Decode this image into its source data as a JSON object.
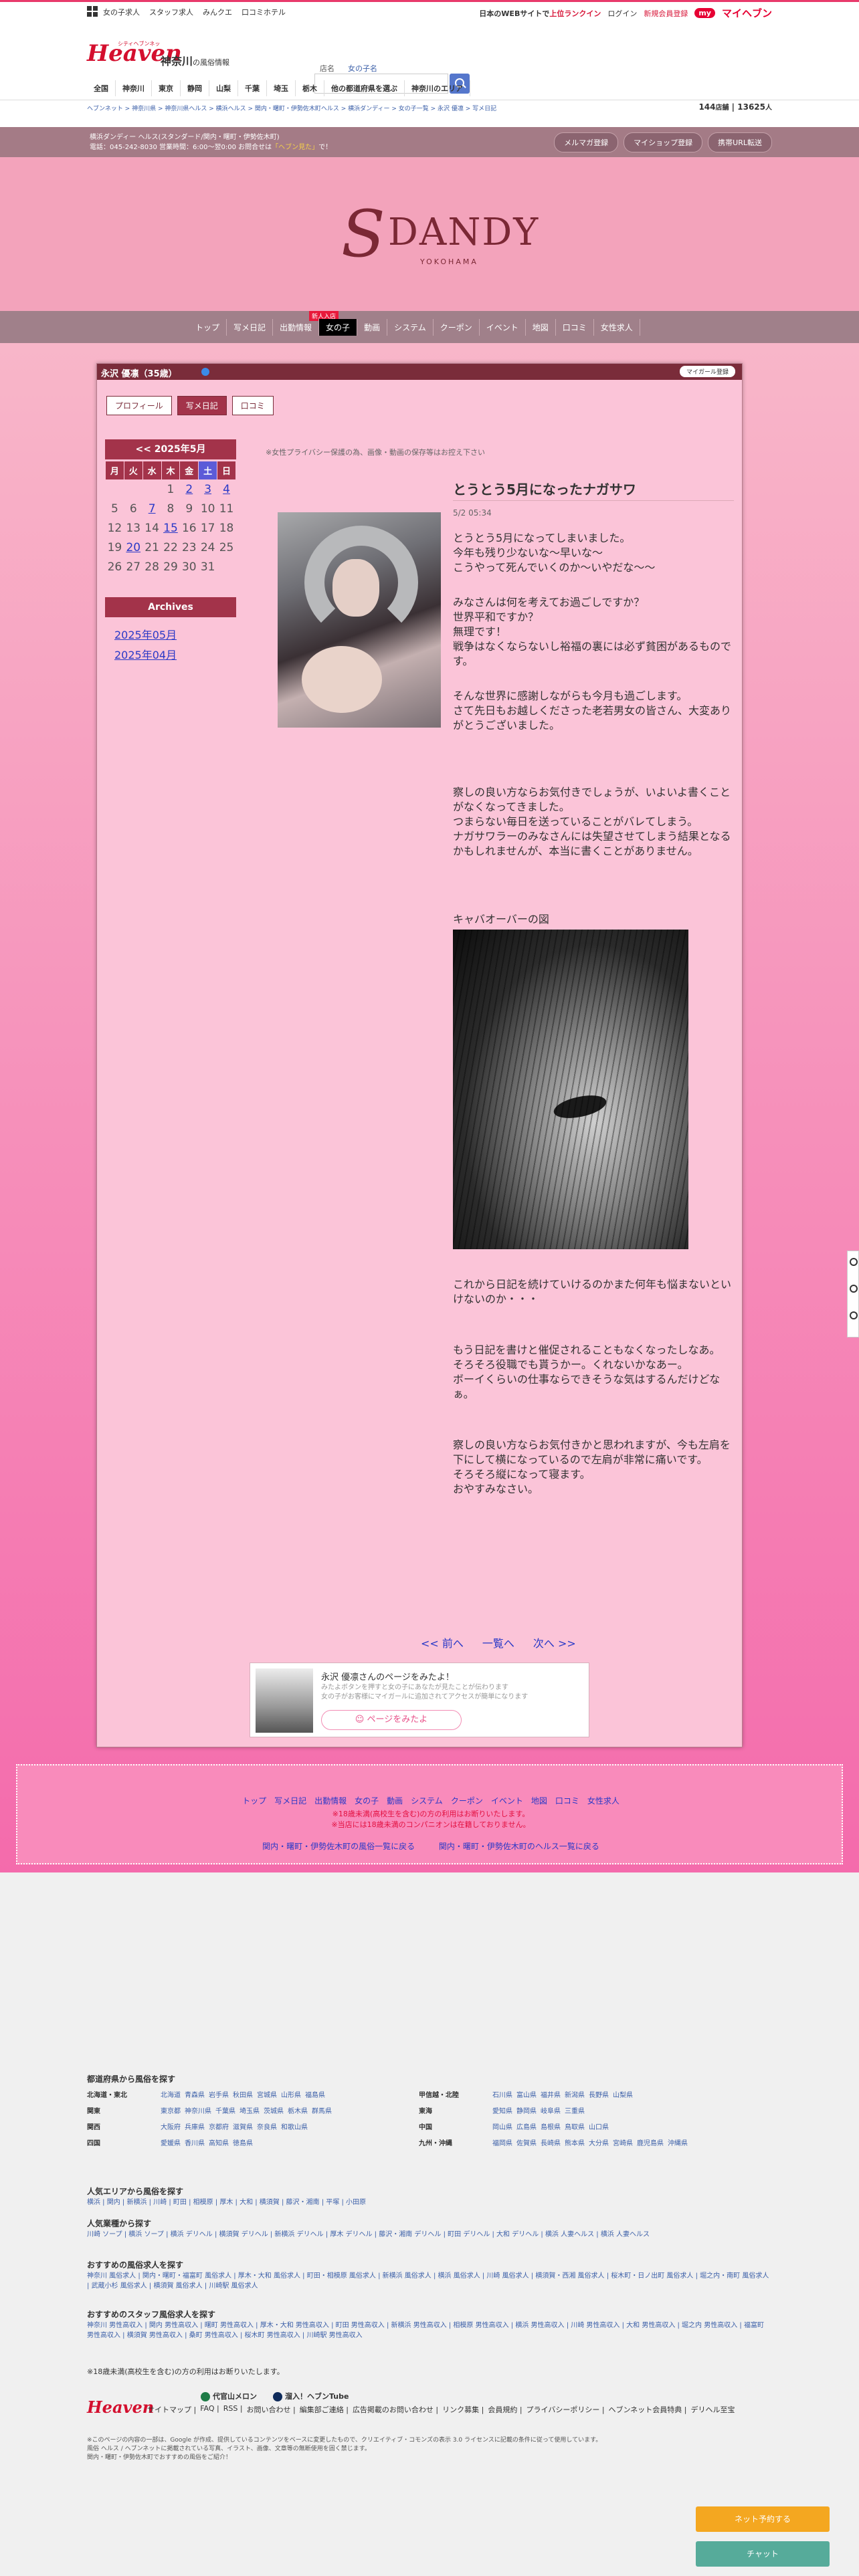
{
  "topbar": {
    "links": [
      "女の子求人",
      "スタッフ求人",
      "みんクエ",
      "口コミホテル"
    ],
    "right_text_a": "日本の",
    "right_text_b": "WEB",
    "right_text_c": "サイトで",
    "right_highlight": "上位ランクイン",
    "login": "ログイン",
    "register": "新規会員登録",
    "my_badge": "my",
    "myheaven": "マイヘブン"
  },
  "header": {
    "logo_text": "Heaven",
    "logo_sub": "シティヘブンネット",
    "region": "神奈川",
    "region_suffix": "の風俗情報",
    "search_label": "店名",
    "search_value": "女の子名",
    "area_nav": [
      "全国",
      "神奈川",
      "東京",
      "静岡",
      "山梨",
      "千葉",
      "埼玉",
      "栃木",
      "他の都道府県を選ぶ",
      "神奈川のエリア"
    ],
    "breadcrumb": "ヘブンネット > 神奈川県 > 神奈川県ヘルス > 横浜ヘルス > 関内・曙町・伊勢佐木町ヘルス > 横浜ダンディー > 女の子一覧 > 永沢 優凛 > 写メ日記",
    "shop_count": "144",
    "shop_unit": "店舗",
    "girl_count": "13625",
    "girl_unit": "人"
  },
  "shopbar": {
    "line1": "横浜ダンディー ヘルス(スタンダード/関内・曙町・伊勢佐木町)",
    "line2a": "電話：045-242-8030 営業時間：6:00〜翌0:00 お問合せは",
    "line2b": "「ヘブン見た」",
    "line2c": "で！",
    "buttons": [
      "メルマガ登録",
      "マイショップ登録",
      "携帯URL転送"
    ]
  },
  "hero": {
    "logo_s": "S",
    "logo_name": "DANDY",
    "logo_city": "YOKOHAMA"
  },
  "gnav": {
    "items": [
      "トップ",
      "写メ日記",
      "出勤情報",
      "女の子",
      "動画",
      "システム",
      "クーポン",
      "イベント",
      "地図",
      "口コミ",
      "女性求人"
    ],
    "new_badge": "新人入店"
  },
  "panel": {
    "girl_name": "永沢 優凛（35歳）",
    "mygirl_btn": "マイガール登録",
    "tabs": [
      "プロフィール",
      "写メ日記",
      "口コミ"
    ]
  },
  "calendar": {
    "title": "<< 2025年5月",
    "weekdays": [
      "月",
      "火",
      "水",
      "木",
      "金",
      "土",
      "日"
    ],
    "weeks": [
      [
        "",
        "",
        "",
        "1",
        "2",
        "3",
        "4"
      ],
      [
        "5",
        "6",
        "7",
        "8",
        "9",
        "10",
        "11"
      ],
      [
        "12",
        "13",
        "14",
        "15",
        "16",
        "17",
        "18"
      ],
      [
        "19",
        "20",
        "21",
        "22",
        "23",
        "24",
        "25"
      ],
      [
        "26",
        "27",
        "28",
        "29",
        "30",
        "31",
        ""
      ]
    ],
    "linked_days": [
      "2",
      "3",
      "4",
      "7",
      "15",
      "20"
    ],
    "archives_title": "Archives",
    "archives": [
      "2025年05月",
      "2025年04月"
    ]
  },
  "diary": {
    "privacy_note": "※女性プライバシー保護の為、画像・動画の保存等はお控え下さい",
    "title": "とうとう5月になったナガサワ",
    "date": "5/2 05:34",
    "para1": "とうとう5月になってしまいました。\n今年も残り少ないな〜早いな〜\nこうやって死んでいくのか〜いやだな〜〜",
    "para2": "みなさんは何を考えてお過ごしですか？\n世界平和ですか？\n無理です！\n戦争はなくならないし裕福の裏には必ず貧困があるものです。",
    "para3": "そんな世界に感謝しながらも今月も過ごします。\nさて先日もお越しくださった老若男女の皆さん、大変ありがとうございました。",
    "para4": "察しの良い方ならお気付きでしょうが、いよいよ書くことがなくなってきました。\nつまらない毎日を送っていることがバレてしまう。\nナガサワラーのみなさんには失望させてしまう結果となるかもしれませんが、本当に書くことがありません。",
    "caption": "キャバオーバーの図",
    "para5": "これから日記を続けていけるのかまた何年も悩まないといけないのか・・・",
    "para6": "もう日記を書けと催促されることもなくなったしなあ。\nそろそろ役職でも貰うかー。くれないかなあー。\nボーイくらいの仕事ならできそうな気はするんだけどなぁ。",
    "para7": "察しの良い方ならお気付きかと思われますが、今も左肩を下にして横になっているので左肩が非常に痛いです。\nそろそろ縦になって寝ます。\nおやすみなさい。"
  },
  "pager": [
    "<< 前へ",
    "一覧へ",
    "次へ >>"
  ],
  "profile_card": {
    "title": "永沢 優凛さんのページをみたよ！",
    "desc1": "みたよボタンを押すと女の子にあなたが見たことが伝わります",
    "desc2": "女の子がお客様にマイガールに追加されてアクセスが簡単になります",
    "button": "ページをみたよ"
  },
  "footer_box": {
    "links": [
      "トップ",
      "写メ日記",
      "出勤情報",
      "女の子",
      "動画",
      "システム",
      "クーポン",
      "イベント",
      "地図",
      "口コミ",
      "女性求人"
    ],
    "note1": "※18歳未満(高校生を含む)の方の利用はお断りいたします。",
    "note2": "※当店には18歳未満のコンパニオンは在籍しておりません。",
    "back_links": [
      "関内・曙町・伊勢佐木町の風俗一覧に戻る",
      "関内・曙町・伊勢佐木町のヘルス一覧に戻る"
    ]
  },
  "site_footer": {
    "pref_heading": "都道府県から風俗を探す",
    "pref_rows_left": [
      {
        "region": "北海道・東北",
        "prefs": [
          "北海道",
          "青森県",
          "岩手県",
          "秋田県",
          "宮城県",
          "山形県",
          "福島県"
        ]
      },
      {
        "region": "関東",
        "prefs": [
          "東京都",
          "神奈川県",
          "千葉県",
          "埼玉県",
          "茨城県",
          "栃木県",
          "群馬県"
        ]
      },
      {
        "region": "関西",
        "prefs": [
          "大阪府",
          "兵庫県",
          "京都府",
          "滋賀県",
          "奈良県",
          "和歌山県"
        ]
      },
      {
        "region": "四国",
        "prefs": [
          "愛媛県",
          "香川県",
          "高知県",
          "徳島県"
        ]
      }
    ],
    "pref_rows_right": [
      {
        "region": "甲信越・北陸",
        "prefs": [
          "石川県",
          "富山県",
          "福井県",
          "新潟県",
          "長野県",
          "山梨県"
        ]
      },
      {
        "region": "東海",
        "prefs": [
          "愛知県",
          "静岡県",
          "岐阜県",
          "三重県"
        ]
      },
      {
        "region": "中国",
        "prefs": [
          "岡山県",
          "広島県",
          "島根県",
          "鳥取県",
          "山口県"
        ]
      },
      {
        "region": "九州・沖縄",
        "prefs": [
          "福岡県",
          "佐賀県",
          "長崎県",
          "熊本県",
          "大分県",
          "宮崎県",
          "鹿児島県",
          "沖縄県"
        ]
      }
    ],
    "popular_area_heading": "人気エリアから風俗を探す",
    "popular_area": "横浜 | 関内 | 新横浜 | 川崎 | 町田 | 相模原 | 厚木 | 大和 | 横須賀 | 藤沢・湘南 | 平塚 | 小田原",
    "popular_type_heading": "人気業種から探す",
    "popular_type": "川崎 ソープ | 横浜 ソープ | 横浜 デリヘル | 横須賀 デリヘル | 新横浜 デリヘル | 厚木 デリヘル | 藤沢・湘南 デリヘル | 町田 デリヘル | 大和 デリヘル | 横浜 人妻ヘルス | 横浜 人妻ヘルス",
    "job_heading": "おすすめの風俗求人を探す",
    "job": "神奈川 風俗求人 | 関内・曙町・福富町 風俗求人 | 厚木・大和 風俗求人 | 町田・相模原 風俗求人 | 新横浜 風俗求人 | 横浜 風俗求人 | 川崎 風俗求人 | 横須賀・西湘 風俗求人 | 桜木町・日ノ出町 風俗求人 | 堀之内・南町 風俗求人 | 武蔵小杉 風俗求人 | 横須賀 風俗求人 | 川崎駅 風俗求人",
    "staff_heading": "おすすめのスタッフ風俗求人を探す",
    "staff": "神奈川 男性高収入 | 関内 男性高収入 | 曙町 男性高収入 | 厚木・大和 男性高収入 | 町田 男性高収入 | 新横浜 男性高収入 | 相模原 男性高収入 | 横浜 男性高収入 | 川崎 男性高収入 | 大和 男性高収入 | 堀之内 男性高収入 | 福富町 男性高収入 | 横須賀 男性高収入 | 桑町 男性高収入 | 桜木町 男性高収入 | 川崎駅 男性高収入",
    "age_note": "※18歳未満(高校生を含む)の方の利用はお断りいたします。",
    "logo": "Heaven",
    "social": [
      "代官山メロン",
      "溜入！ヘブンTube"
    ],
    "menu": [
      "サイトマップ",
      "FAQ",
      "RSS",
      "お問い合わせ",
      "編集部ご連絡",
      "広告掲載のお問い合わせ",
      "リンク募集",
      "会員規約",
      "プライバシーポリシー",
      "ヘブンネット会員特典",
      "デリヘル至宝"
    ],
    "small1": "※このページの内容の一部は、Google が作成、提供しているコンテンツをベースに変更したもので、クリエイティブ・コモンズの表示 3.0 ライセンスに記載の条件に従って使用しています。",
    "small2": "風俗 ヘルス / ヘブンネットに掲載されている写真、イラスト、画像、文章等の無断使用を固く禁じます。",
    "small3": "関内・曙町・伊勢佐木町でおすすめの風俗をご紹介！"
  },
  "floating": {
    "net_btn": "ネット予約する",
    "chat_btn": "チャット"
  }
}
